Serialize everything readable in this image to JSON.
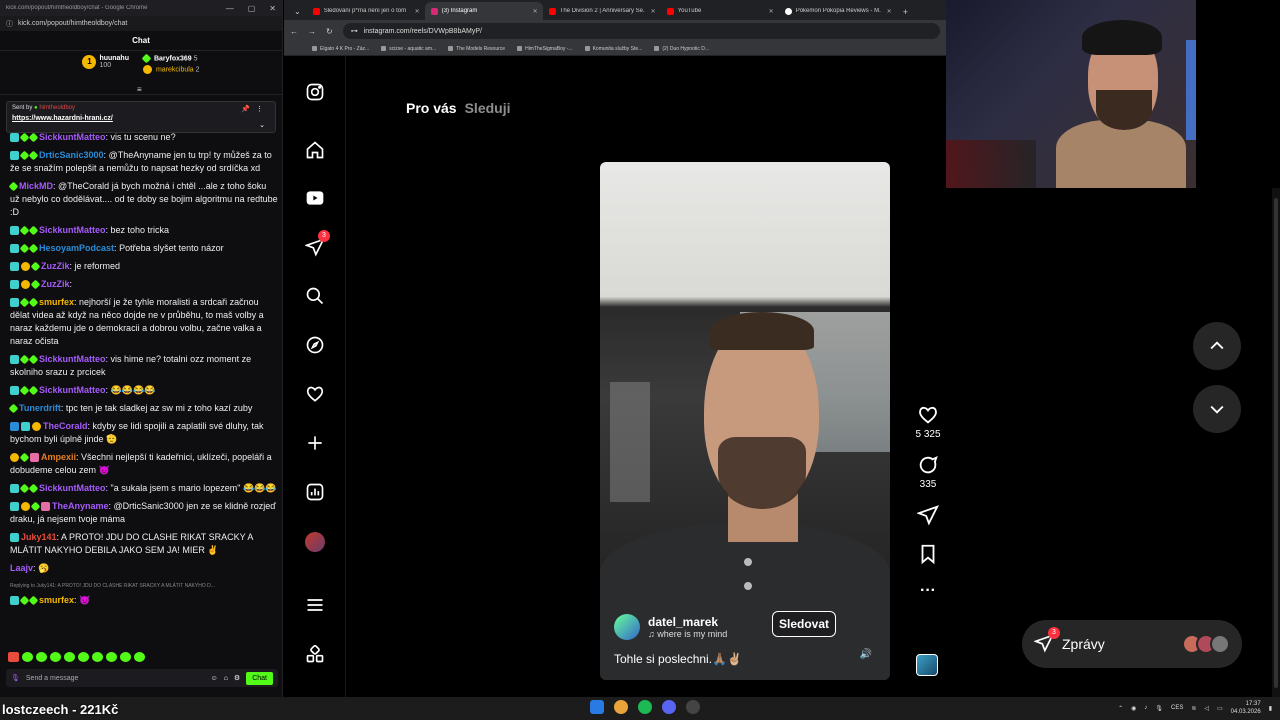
{
  "chat_window": {
    "title": "kick.com/popout/himtheoldboy/chat - Google Chrome",
    "url": "kick.com/popout/himtheoldboy/chat",
    "header": "Chat",
    "leaderboard": [
      {
        "name": "huunahu",
        "value": "100"
      },
      {
        "name": "Baryfox369",
        "value": "5"
      },
      {
        "name": "marekcibula",
        "value": "2"
      }
    ],
    "pinned": {
      "sent_by_label": "Sent by",
      "sender": "himtheoldboy",
      "link": "https://www.hazardni-hrani.cz/"
    },
    "messages": [
      {
        "user": "SickkuntMatteo",
        "color": "#a55bfa",
        "text": "vis tu scenu ne?"
      },
      {
        "user": "DrticSanic3000",
        "color": "#2a8cd9",
        "text": "@TheAnyname jen tu trp! ty můžeš za to že se snažím polepšit a nemůžu to napsat hezky od srdíčka xd"
      },
      {
        "user": "MickMD",
        "color": "#a55bfa",
        "text": "@TheCorald já bych možná i chtěl ...ale z toho šoku už nebylo co dodělávat.... od te doby se bojim algoritmu na redtube :D"
      },
      {
        "user": "SickkuntMatteo",
        "color": "#a55bfa",
        "text": "bez toho tricka"
      },
      {
        "user": "HesoyamPodcast",
        "color": "#2a8cd9",
        "text": "Potřeba slyšet tento názor"
      },
      {
        "user": "ZuzZik",
        "color": "#a55bfa",
        "text": "je reformed"
      },
      {
        "user": "ZuzZik",
        "color": "#a55bfa",
        "text": ""
      },
      {
        "user": "smurfex",
        "color": "#f5b800",
        "text": "nejhorší je že tyhle moralisti a srdcaři začnou dělat videa až když na něco dojde ne v průběhu, to maš volby a naraz každemu jde o demokracii a dobrou volbu, začne valka a naraz očista"
      },
      {
        "user": "SickkuntMatteo",
        "color": "#a55bfa",
        "text": "vis hime ne? totalni ozz moment ze skolniho srazu z prcicek"
      },
      {
        "user": "SickkuntMatteo",
        "color": "#a55bfa",
        "text": "😂😂😂😂"
      },
      {
        "user": "Tunerdrift",
        "color": "#2a8cd9",
        "text": "tpc ten je tak sladkej az sw mi z toho kazí zuby"
      },
      {
        "user": "TheCorald",
        "color": "#a55bfa",
        "text": "kdyby se lidi spojili a zaplatili své dluhy, tak bychom byli úplně jinde 🫡"
      },
      {
        "user": "Ampexii",
        "color": "#e67e22",
        "text": "Všechni nejlepší ti kadeřnici, uklízeči, popeláři a dobudeme celou zem 😈"
      },
      {
        "user": "SickkuntMatteo",
        "color": "#a55bfa",
        "text": "\"a sukala jsem s mario lopezem\" 😂😂😂"
      },
      {
        "user": "TheAnyname",
        "color": "#a55bfa",
        "text": "@DrticSanic3000 jen ze se klidně rozjeď draku, já nejsem tvoje máma"
      },
      {
        "user": "Juky141",
        "color": "#e74c3c",
        "text": "A PROTO! JDU DO CLASHE RIKAT SRACKY A MLÁTIT NAKYHO DEBILA JAKO SEM JA! MIER ✌"
      },
      {
        "user": "Laajv",
        "color": "#a55bfa",
        "text": "🥱"
      },
      {
        "user": "smurfex",
        "color": "#f5b800",
        "text": "😈",
        "reply": "Replying to Juky141: A PROTO! JDU DO CLASHE RIKAT SRACKY A MLÁTIT NAKYHO D..."
      }
    ],
    "input_placeholder": "Send a message",
    "send_label": "Chat"
  },
  "browser": {
    "tabs": [
      {
        "label": "Sledování p*rna není jen o tom",
        "active": false,
        "icon": "youtube-icon"
      },
      {
        "label": "(3) Instagram",
        "active": true,
        "icon": "instagram-icon"
      },
      {
        "label": "The Division 2 | Anniversary Se...",
        "active": false,
        "icon": "youtube-icon"
      },
      {
        "label": "YouTube",
        "active": false,
        "icon": "youtube-icon"
      },
      {
        "label": "Pokemon Pokopia Reviews - M...",
        "active": false,
        "icon": "pokemon-icon"
      }
    ],
    "url": "instagram.com/reels/DVWpB8bAMyP/",
    "bookmarks": [
      "Elgato 4 K Pro - Záz...",
      "scizse - aquatic am...",
      "The Models Resource",
      "HimTheSigmaBoy -...",
      "Komunita služby Ste...",
      "(2) Duo Hypnotic D..."
    ]
  },
  "instagram": {
    "nav_badge": "3",
    "feed_tabs": {
      "active": "Pro vás",
      "inactive": "Sleduji"
    },
    "reel": {
      "username": "datel_marek",
      "song": "where is my mind",
      "follow_label": "Sledovat",
      "caption": "Tohle si poslechni.🙏🏽✌🏼",
      "likes": "5 325",
      "comments": "335"
    },
    "messages_pill": {
      "label": "Zprávy",
      "badge": "3"
    }
  },
  "overlay": {
    "text": "lostczeech - 221Kč"
  },
  "tray": {
    "lang": "CES",
    "time": "17:37",
    "date": "04.03.2026"
  }
}
